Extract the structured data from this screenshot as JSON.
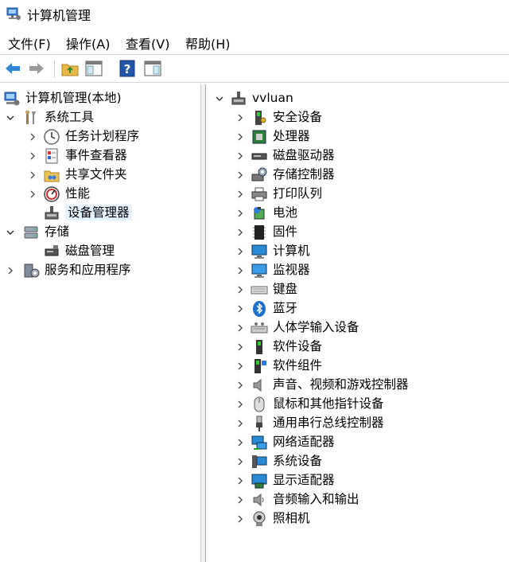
{
  "window": {
    "title": "计算机管理"
  },
  "menu": {
    "file": "文件(F)",
    "action": "操作(A)",
    "view": "查看(V)",
    "help": "帮助(H)"
  },
  "left_tree": {
    "root": "计算机管理(本地)",
    "system_tools": "系统工具",
    "task_scheduler": "任务计划程序",
    "event_viewer": "事件查看器",
    "shared_folders": "共享文件夹",
    "performance": "性能",
    "device_manager": "设备管理器",
    "storage": "存储",
    "disk_management": "磁盘管理",
    "services_apps": "服务和应用程序"
  },
  "device_tree": {
    "root": "vvluan",
    "categories": [
      "安全设备",
      "处理器",
      "磁盘驱动器",
      "存储控制器",
      "打印队列",
      "电池",
      "固件",
      "计算机",
      "监视器",
      "键盘",
      "蓝牙",
      "人体学输入设备",
      "软件设备",
      "软件组件",
      "声音、视频和游戏控制器",
      "鼠标和其他指针设备",
      "通用串行总线控制器",
      "网络适配器",
      "系统设备",
      "显示适配器",
      "音频输入和输出",
      "照相机"
    ]
  }
}
